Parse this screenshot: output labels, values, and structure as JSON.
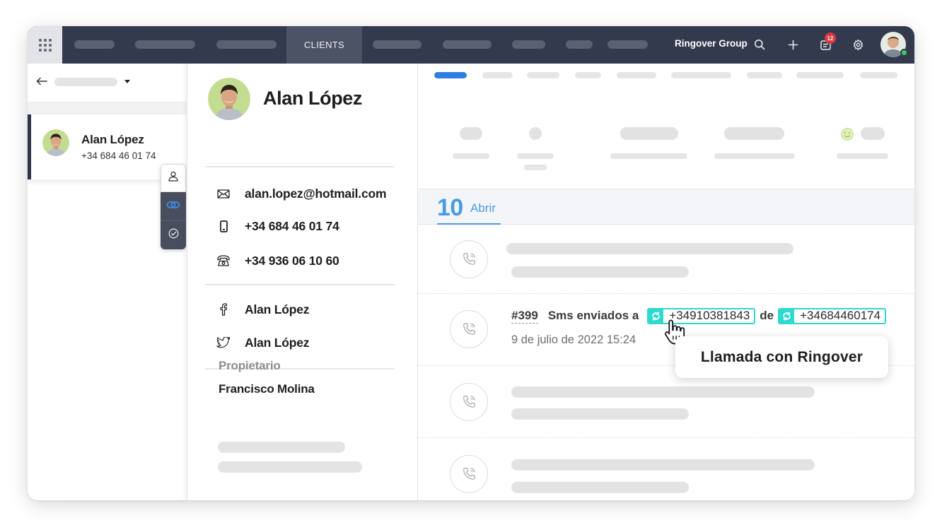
{
  "topbar": {
    "active_tab": "CLIENTS",
    "org_name": "Ringover Group",
    "notification_count": "12"
  },
  "contact_list": {
    "selected": {
      "name": "Alan López",
      "phone": "+34 684 46 01 74"
    }
  },
  "contact": {
    "name": "Alan López",
    "email": "alan.lopez@hotmail.com",
    "mobile": "+34 684 46 01 74",
    "landline": "+34 936 06 10 60",
    "facebook": "Alan López",
    "twitter": "Alan López",
    "owner_label": "Propietario",
    "owner_value": "Francisco Molina"
  },
  "timeline": {
    "date_day": "10",
    "date_month": "Abrir",
    "event": {
      "id": "#399",
      "text": "Sms enviados a",
      "to_number": "+34910381843",
      "connector": "de",
      "from_number": "+34684460174",
      "date": "9 de julio de 2022 15:24"
    }
  },
  "tooltip": {
    "text": "Llamada con Ringover"
  },
  "colors": {
    "topbar_bg": "#343a4e",
    "accent_blue": "#4a9ae6",
    "chip_teal": "#2ed9ce",
    "badge_red": "#e0373d",
    "online_green": "#42c65f"
  },
  "icons": {
    "apps": "grid-icon",
    "search": "search-icon",
    "add": "plus-icon",
    "notifications": "notification-list-icon",
    "settings": "gear-icon",
    "back": "arrow-left-icon",
    "contact_tool": "user-icon",
    "integration_tool": "link-rings-icon",
    "tasks_tool": "check-circle-icon",
    "email": "envelope-icon",
    "mobile": "mobile-phone-icon",
    "landline": "telephone-icon",
    "facebook": "facebook-icon",
    "twitter": "twitter-icon",
    "call": "phone-call-icon",
    "chip": "ringover-sync-icon",
    "cursor": "hand-pointer-icon"
  }
}
